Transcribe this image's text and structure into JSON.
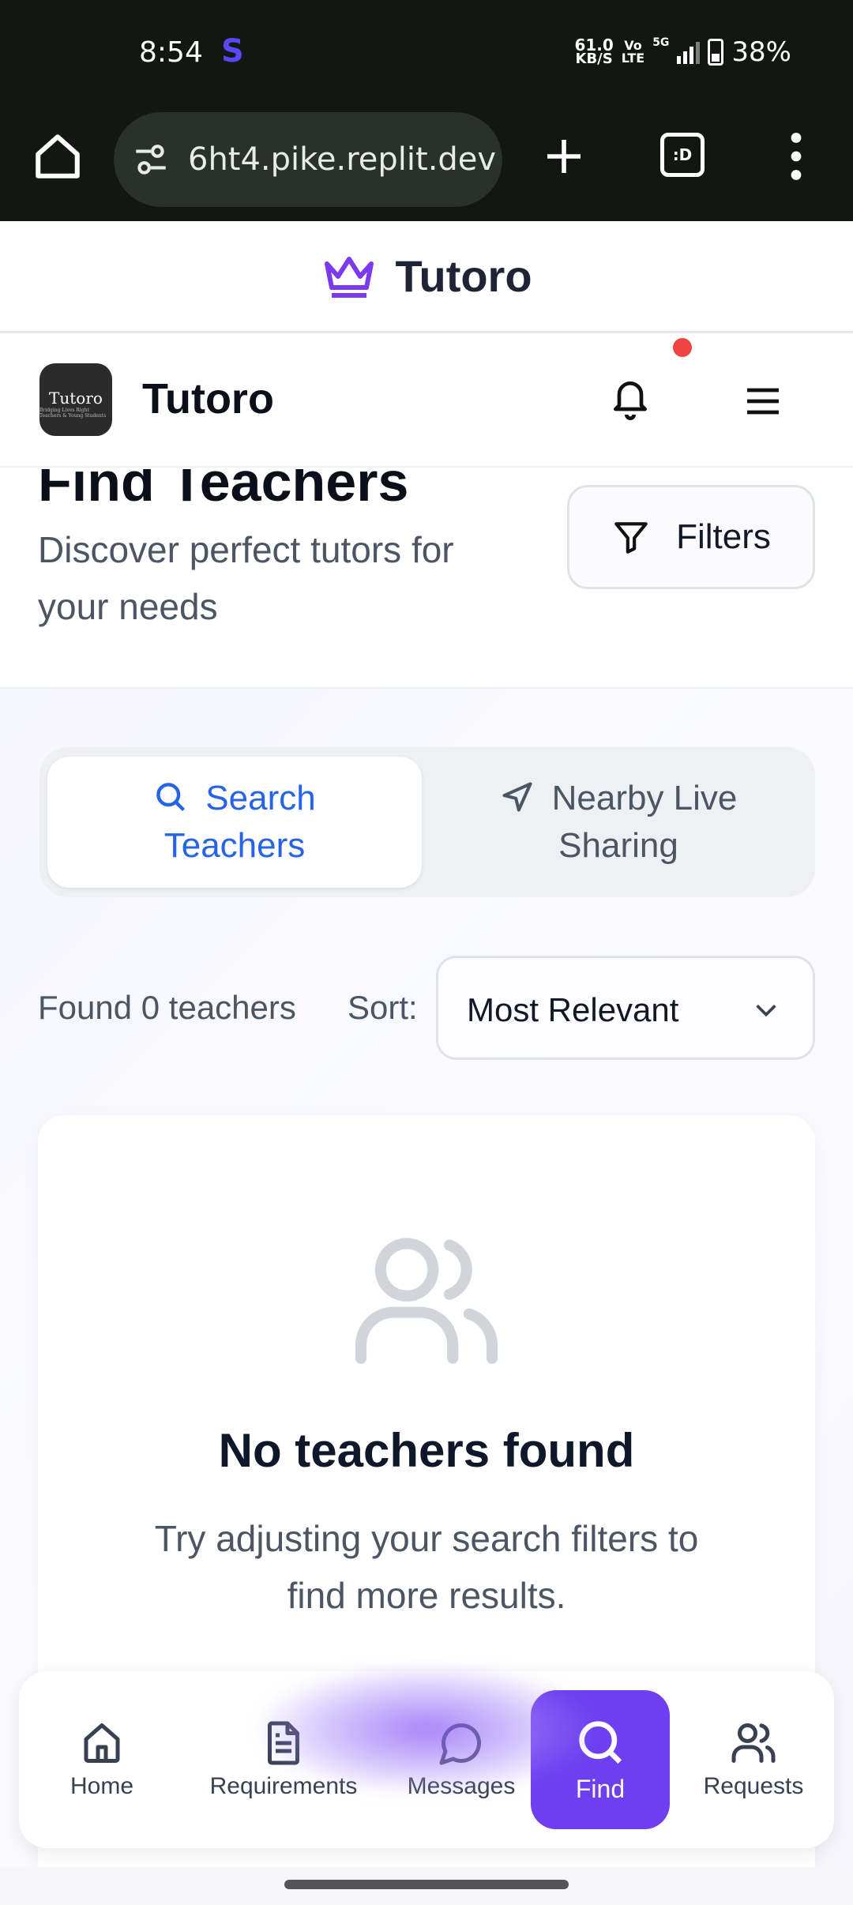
{
  "status_bar": {
    "time": "8:54",
    "app_indicator": "S",
    "net_speed_value": "61.0",
    "net_speed_unit": "KB/S",
    "volte_top": "Vo",
    "volte_bottom": "LTE",
    "network": "5G",
    "battery": "38%"
  },
  "browser": {
    "url": "6ht4.pike.replit.dev",
    "tabs_label": ":D"
  },
  "brand_header": {
    "title": "Tutoro"
  },
  "app_header": {
    "logo_text": "Tutoro",
    "logo_subtext": "Bridging Lives Right Teachers & Young Students",
    "title": "Tutoro"
  },
  "page": {
    "title": "Find Teachers",
    "subtitle": "Discover perfect tutors for your needs",
    "filters_label": "Filters"
  },
  "tabs": {
    "search_line1": "Search",
    "search_line2": "Teachers",
    "nearby_line1": "Nearby Live",
    "nearby_line2": "Sharing"
  },
  "results": {
    "found_text": "Found 0 teachers",
    "sort_label": "Sort:",
    "sort_value": "Most Relevant"
  },
  "empty_state": {
    "title": "No teachers found",
    "description": "Try adjusting your search filters to find more results."
  },
  "bottom_nav": {
    "home": "Home",
    "requirements": "Requirements",
    "messages": "Messages",
    "find": "Find",
    "requests": "Requests"
  },
  "colors": {
    "accent": "#6d3ff0",
    "link_blue": "#2563eb",
    "notification": "#ef4444"
  }
}
